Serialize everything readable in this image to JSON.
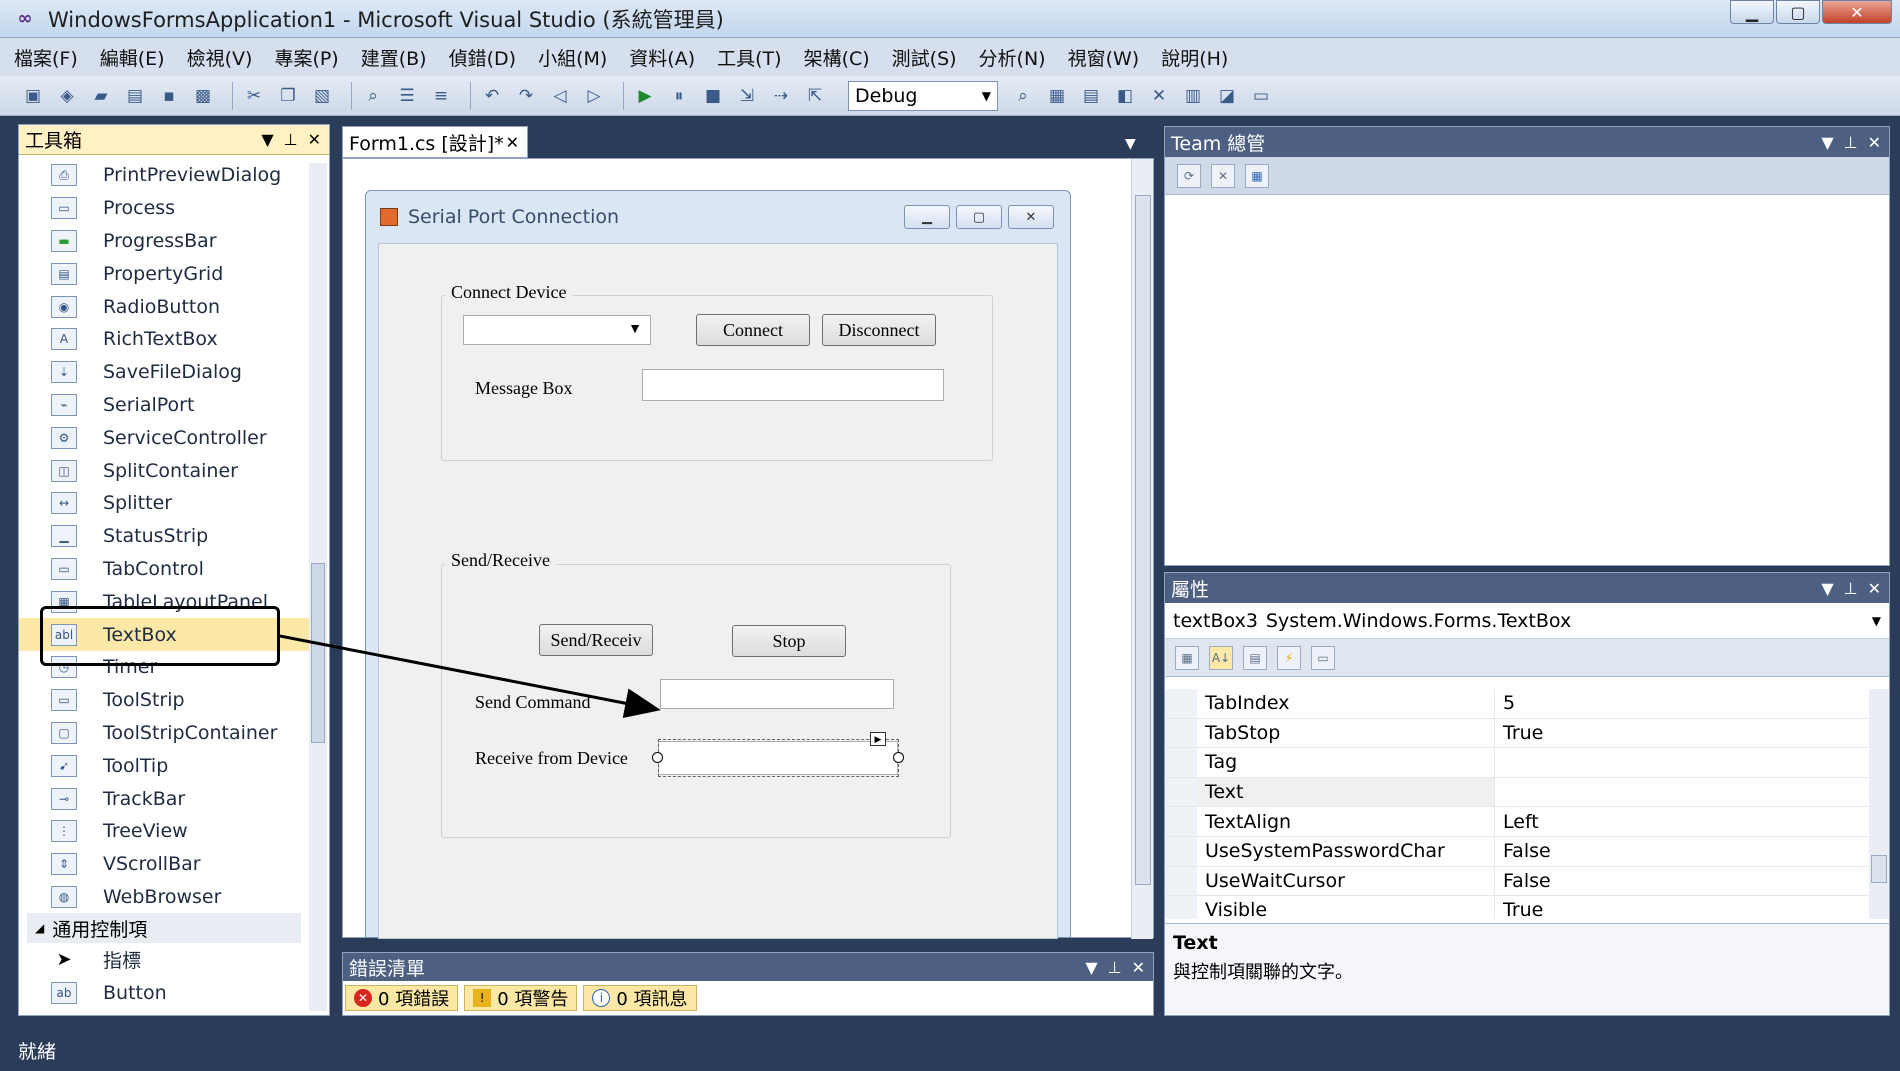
{
  "window": {
    "title": "WindowsFormsApplication1 - Microsoft Visual Studio (系統管理員)",
    "minimize": "▁",
    "maximize": "▢",
    "close": "✕"
  },
  "menu": [
    "檔案(F)",
    "編輯(E)",
    "檢視(V)",
    "專案(P)",
    "建置(B)",
    "偵錯(D)",
    "小組(M)",
    "資料(A)",
    "工具(T)",
    "架構(C)",
    "測試(S)",
    "分析(N)",
    "視窗(W)",
    "說明(H)"
  ],
  "toolbar": {
    "config": "Debug"
  },
  "toolbox": {
    "title": "工具箱",
    "items": [
      {
        "label": "PrintPreviewDialog",
        "icon": "print-preview-icon"
      },
      {
        "label": "Process",
        "icon": "process-icon"
      },
      {
        "label": "ProgressBar",
        "icon": "progressbar-icon"
      },
      {
        "label": "PropertyGrid",
        "icon": "propertygrid-icon"
      },
      {
        "label": "RadioButton",
        "icon": "radiobutton-icon"
      },
      {
        "label": "RichTextBox",
        "icon": "richtextbox-icon"
      },
      {
        "label": "SaveFileDialog",
        "icon": "savefiledialog-icon"
      },
      {
        "label": "SerialPort",
        "icon": "serialport-icon"
      },
      {
        "label": "ServiceController",
        "icon": "servicecontroller-icon"
      },
      {
        "label": "SplitContainer",
        "icon": "splitcontainer-icon"
      },
      {
        "label": "Splitter",
        "icon": "splitter-icon"
      },
      {
        "label": "StatusStrip",
        "icon": "statusstrip-icon"
      },
      {
        "label": "TabControl",
        "icon": "tabcontrol-icon"
      },
      {
        "label": "TableLayoutPanel",
        "icon": "tablelayoutpanel-icon"
      },
      {
        "label": "TextBox",
        "icon": "textbox-icon",
        "selected": true
      },
      {
        "label": "Timer",
        "icon": "timer-icon"
      },
      {
        "label": "ToolStrip",
        "icon": "toolstrip-icon"
      },
      {
        "label": "ToolStripContainer",
        "icon": "toolstripcontainer-icon"
      },
      {
        "label": "ToolTip",
        "icon": "tooltip-icon"
      },
      {
        "label": "TrackBar",
        "icon": "trackbar-icon"
      },
      {
        "label": "TreeView",
        "icon": "treeview-icon"
      },
      {
        "label": "VScrollBar",
        "icon": "vscrollbar-icon"
      },
      {
        "label": "WebBrowser",
        "icon": "webbrowser-icon"
      }
    ],
    "group": "通用控制項",
    "group_items": [
      {
        "label": "指標",
        "icon": "pointer-icon"
      },
      {
        "label": "Button",
        "icon": "button-icon"
      }
    ]
  },
  "designer": {
    "tab": "Form1.cs [設計]*",
    "form_title": "Serial Port Connection",
    "connect_group": "Connect Device",
    "connect_btn": "Connect",
    "disconnect_btn": "Disconnect",
    "message_label": "Message Box",
    "send_group": "Send/Receive",
    "send_receive_btn": "Send/Receiv",
    "stop_btn": "Stop",
    "send_label": "Send Command",
    "receive_label": "Receive from Device"
  },
  "errorlist": {
    "title": "錯誤清單",
    "errors": "0 項錯誤",
    "warnings": "0 項警告",
    "messages": "0 項訊息"
  },
  "team": {
    "title": "Team 總管"
  },
  "properties": {
    "title": "屬性",
    "object_name": "textBox3",
    "object_type": "System.Windows.Forms.TextBox",
    "rows": [
      {
        "name": "TabIndex",
        "value": "5"
      },
      {
        "name": "TabStop",
        "value": "True"
      },
      {
        "name": "Tag",
        "value": ""
      },
      {
        "name": "Text",
        "value": "",
        "selected": true
      },
      {
        "name": "TextAlign",
        "value": "Left"
      },
      {
        "name": "UseSystemPasswordChar",
        "value": "False"
      },
      {
        "name": "UseWaitCursor",
        "value": "False"
      },
      {
        "name": "Visible",
        "value": "True"
      }
    ],
    "desc_title": "Text",
    "desc_text": "與控制項關聯的文字。"
  },
  "status": {
    "text": "就緒"
  }
}
